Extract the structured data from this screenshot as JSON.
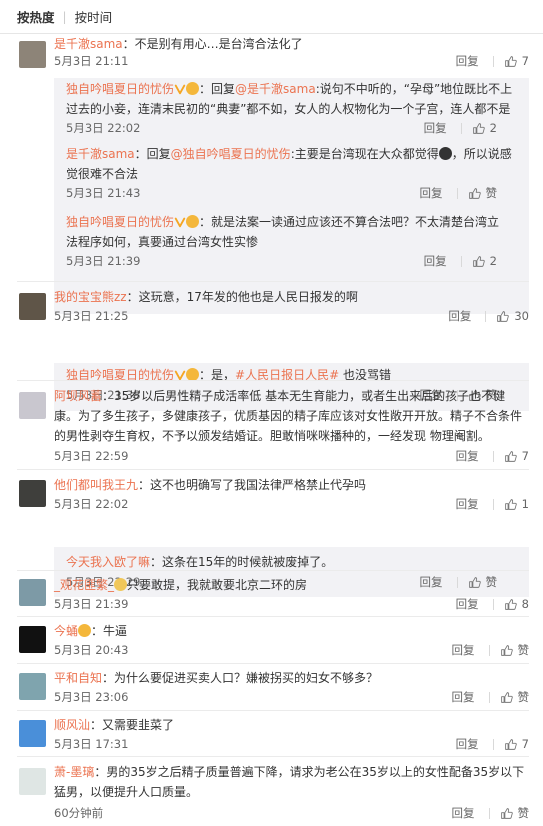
{
  "sort": {
    "hot": "按热度",
    "time": "按时间"
  },
  "actions": {
    "reply": "回复",
    "like": "赞"
  },
  "c1": {
    "name": "是千澈sama",
    "text": "：不是别有用心…是台湾合法化了",
    "time": "5月3日 21:11",
    "likes": "7"
  },
  "r1": {
    "name": "独自吟唱夏日的忧伤",
    "pre": "：回复",
    "at": "@是千澈sama",
    "text1": ":说句不中听的，“孕母”地位既比不上",
    "text2": "过去的小妾，连清末民初的“典妻”都不如，女人的人权物化为一个子宫，连人都不是",
    "time": "5月3日 22:02",
    "likes": "2"
  },
  "r2": {
    "name": "是千澈sama",
    "pre": "：回复",
    "at": "@独自吟唱夏日的忧伤",
    "text1": ":主要是台湾现在大众都觉得",
    "text2": "，所以说感",
    "text3": "觉很难不合法",
    "time": "5月3日 21:43"
  },
  "r3": {
    "name": "独自吟唱夏日的忧伤",
    "text1": "：就是法案一读通过应该还不算合法吧？不太清楚台湾立",
    "text2": "法程序如何，真要通过台湾女性实惨",
    "time": "5月3日 21:39",
    "likes": "2"
  },
  "c2": {
    "name": "我的宝宝熊zz",
    "text": "：这玩意，17年发的他也是人民日报发的啊",
    "time": "5月3日 21:25",
    "likes": "30"
  },
  "r4": {
    "name": "独自吟唱夏日的忧伤",
    "pre": "：是，",
    "hashtag": "#人民日报日人民#",
    "text": " 也没骂错",
    "time": "5月3日 21:38"
  },
  "c3": {
    "name": "阿坝风蓄",
    "text1": "：35岁以后男性精子成活率低 基本无生育能力，或者生出来后的孩子也不健",
    "text2": "康。为了多生孩子，多健康孩子，优质基因的精子库应该对女性敞开开放。精子不合条件",
    "text3": "的男性剥夺生育权，不予以颁发结婚证。胆敢悄咪咪播种的，一经发现 物理阉割。",
    "time": "5月3日 22:59",
    "likes": "7"
  },
  "c4": {
    "name": "他们都叫我王九",
    "text": "：这不也明确写了我国法律严格禁止代孕吗",
    "time": "5月3日 22:02",
    "likes": "1"
  },
  "r5": {
    "name": "今天我入欧了嘛",
    "text": "：这条在15年的时候就被废掉了。",
    "time": "5月3日 22:29"
  },
  "c5": {
    "name": "_观花匪繁_",
    "text": "只要敢提，我就敢要北京二环的房",
    "time": "5月3日 21:39",
    "likes": "8"
  },
  "c6": {
    "name": "今蛹",
    "text": "：牛逼",
    "time": "5月3日 20:43"
  },
  "c7": {
    "name": "平和自知",
    "text": "：为什么要促进买卖人口？嫌被拐买的妇女不够多？",
    "time": "5月3日 23:06"
  },
  "c8": {
    "name": "顺风汕",
    "text": "：又需要韭菜了",
    "time": "5月3日 17:31",
    "likes": "7"
  },
  "c9": {
    "name": "萧-墨璃",
    "text1": "：男的35岁之后精子质量普遍下降，请求为老公在35岁以上的女性配备35岁以下",
    "text2": "猛男，以便提升人口质量。",
    "time": "60分钟前"
  },
  "colors": {
    "name": "#eb7350",
    "reply_bg": "#f2f2f5",
    "text": "#333333",
    "meta": "#666666"
  }
}
